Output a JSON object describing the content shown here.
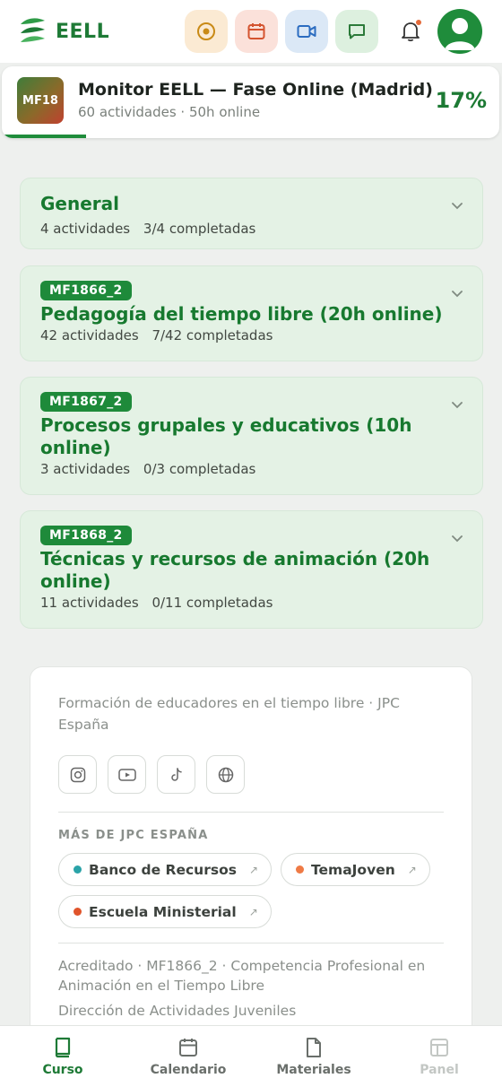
{
  "brand": {
    "name": "EELL"
  },
  "header": {
    "quick_actions": [
      {
        "name": "target",
        "color": "#c98a16"
      },
      {
        "name": "calendar",
        "color": "#d4532f"
      },
      {
        "name": "video",
        "color": "#2b6cc0"
      },
      {
        "name": "chat",
        "color": "#2c7a3a"
      }
    ],
    "has_notification": true
  },
  "course": {
    "badge": "MF18",
    "title": "Monitor EELL — Fase Online (Madrid)",
    "subtitle": "60 actividades · 50h online",
    "progress_label": "17%",
    "progress": 0.17
  },
  "sections": [
    {
      "title": "General",
      "activities": "4 actividades",
      "completed": "3/4 completadas"
    },
    {
      "code": "MF1866_2",
      "title": "Pedagogía del tiempo libre (20h online)",
      "activities": "42 actividades",
      "completed": "7/42 completadas"
    },
    {
      "code": "MF1867_2",
      "title": "Procesos grupales y educativos (10h online)",
      "activities": "3 actividades",
      "completed": "0/3 completadas"
    },
    {
      "code": "MF1868_2",
      "title": "Técnicas y recursos de animación (20h online)",
      "activities": "11 actividades",
      "completed": "0/11 completadas"
    }
  ],
  "footer": {
    "description": "Formación de educadores en el tiempo libre · JPC España",
    "socials": [
      "instagram",
      "youtube",
      "tiktok",
      "web"
    ],
    "more_title": "MÁS DE JPC ESPAÑA",
    "links": [
      {
        "label": "Banco de Recursos",
        "color": "#2aa3a8"
      },
      {
        "label": "TemaJoven",
        "color": "#ef7a45"
      },
      {
        "label": "Escuela Ministerial",
        "color": "#e0542b"
      }
    ],
    "accreditation": "Acreditado · MF1866_2 · Competencia Profesional en Animación en el Tiempo Libre",
    "cut_line": "Dirección de Actividades Juveniles"
  },
  "nav": [
    {
      "label": "Curso",
      "state": "active"
    },
    {
      "label": "Calendario",
      "state": "normal"
    },
    {
      "label": "Materiales",
      "state": "normal"
    },
    {
      "label": "Panel",
      "state": "disabled"
    }
  ]
}
